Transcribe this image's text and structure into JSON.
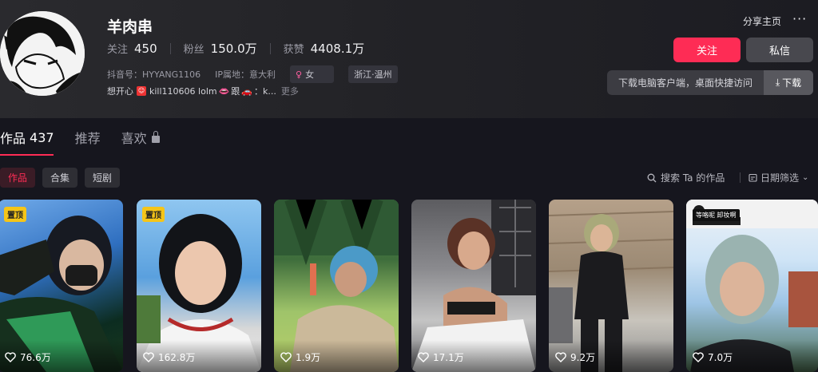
{
  "profile": {
    "name": "羊肉串",
    "stats": [
      {
        "label": "关注",
        "value": "450"
      },
      {
        "label": "粉丝",
        "value": "150.0万"
      },
      {
        "label": "获赞",
        "value": "4408.1万"
      }
    ],
    "douyin_id": "抖音号：HYYANG1106",
    "ip_location": "IP属地：意大利",
    "tags": [
      {
        "label": "女",
        "icon": "female-icon"
      },
      {
        "label": "浙江·温州"
      }
    ],
    "bio": {
      "prefix": "想开心",
      "text": "kill110606 lolm",
      "suffix": "跟",
      "tail": "：k...",
      "more": "更多"
    }
  },
  "actions": {
    "share": "分享主页",
    "more": "···",
    "follow": "关注",
    "message": "私信",
    "download_prompt": "下载电脑客户端，桌面快捷访问",
    "download_btn": "下载"
  },
  "tabs": [
    {
      "label": "作品",
      "count": "437",
      "active": true
    },
    {
      "label": "推荐"
    },
    {
      "label": "喜欢",
      "locked": true
    }
  ],
  "filters": [
    "作品",
    "合集",
    "短剧"
  ],
  "search_placeholder": "搜索 Ta 的作品",
  "date_filter": "日期筛选",
  "videos": [
    {
      "likes": "76.6万",
      "pinned": "置顶"
    },
    {
      "likes": "162.8万",
      "pinned": "置顶"
    },
    {
      "likes": "1.9万"
    },
    {
      "likes": "17.1万"
    },
    {
      "likes": "9.2万"
    },
    {
      "likes": "7.0万",
      "caption": "等咯呢 卸妆啊"
    }
  ],
  "colors": {
    "accent": "#fe2c55",
    "pin": "#f5c518"
  }
}
